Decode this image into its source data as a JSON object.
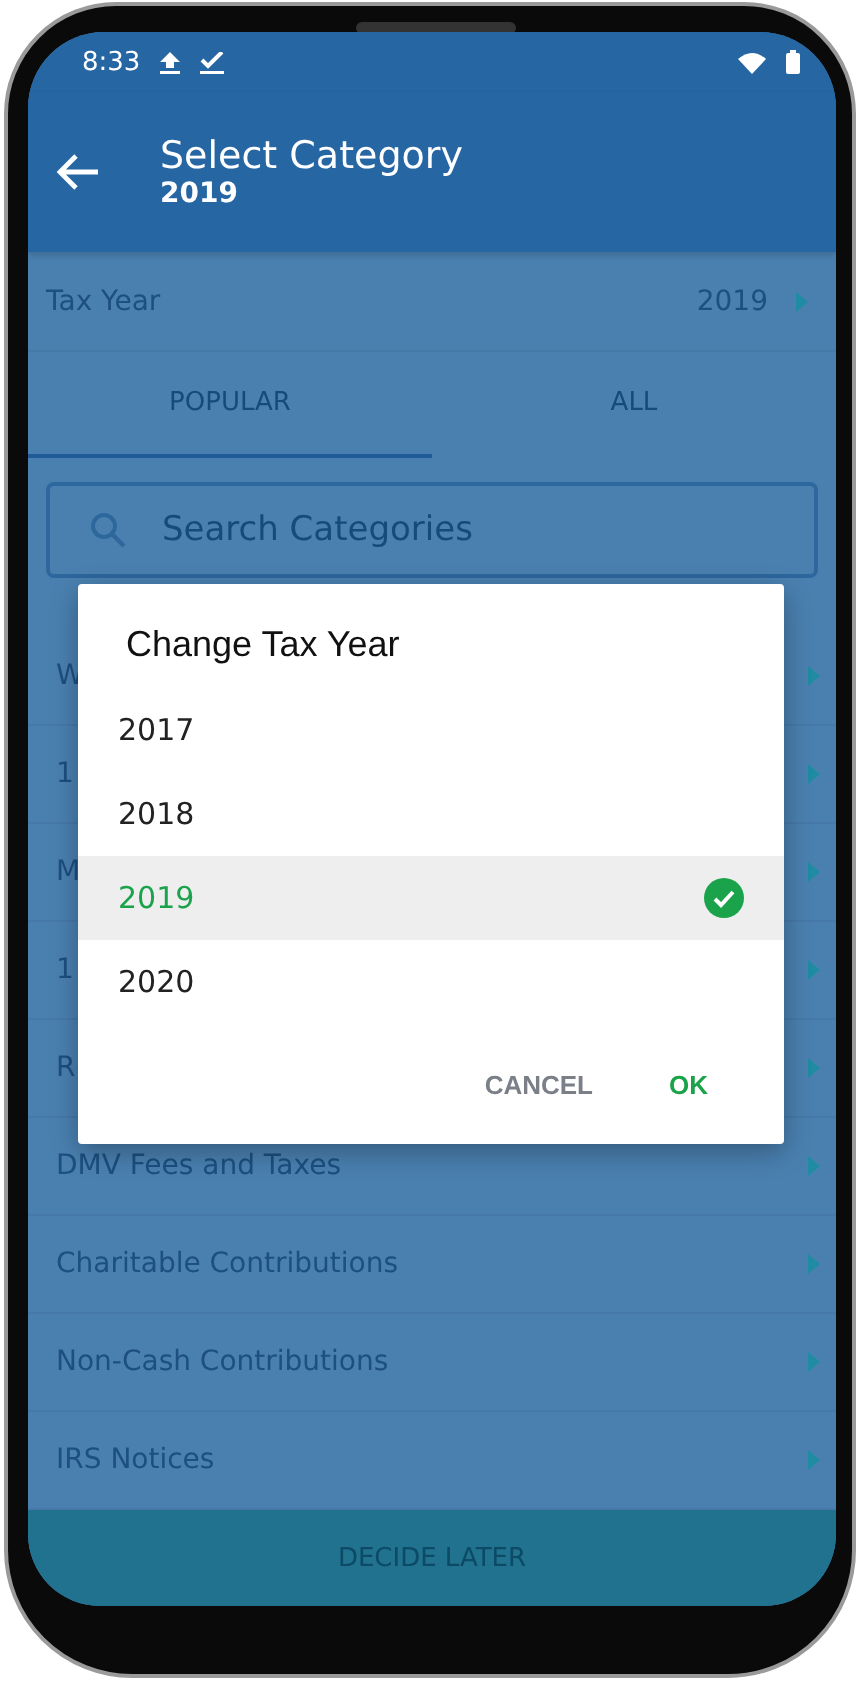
{
  "status_bar": {
    "time": "8:33"
  },
  "app_bar": {
    "title": "Select Category",
    "subtitle": "2019"
  },
  "tax_year_row": {
    "label": "Tax Year",
    "value": "2019"
  },
  "tabs": [
    {
      "label": "POPULAR",
      "selected": true
    },
    {
      "label": "ALL",
      "selected": false
    }
  ],
  "search": {
    "placeholder": "Search Categories"
  },
  "categories": [
    "W",
    "1",
    "M",
    "1",
    "R",
    "DMV Fees and Taxes",
    "Charitable Contributions",
    "Non-Cash Contributions",
    "IRS Notices"
  ],
  "footer_button": "DECIDE LATER",
  "dialog": {
    "title": "Change Tax Year",
    "options": [
      {
        "label": "2017",
        "selected": false
      },
      {
        "label": "2018",
        "selected": false
      },
      {
        "label": "2019",
        "selected": true
      },
      {
        "label": "2020",
        "selected": false
      }
    ],
    "buttons": [
      {
        "label": "CANCEL",
        "kind": "secondary"
      },
      {
        "label": "OK",
        "kind": "primary"
      }
    ]
  }
}
